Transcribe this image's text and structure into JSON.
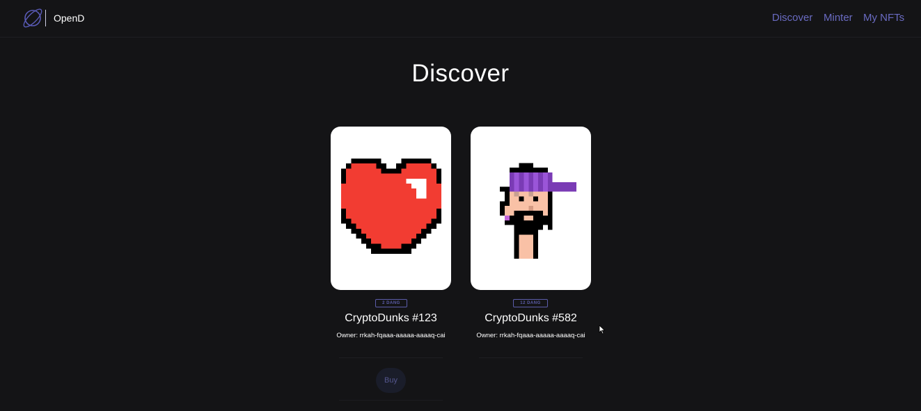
{
  "header": {
    "brand": "OpenD",
    "nav": [
      {
        "label": "Discover"
      },
      {
        "label": "Minter"
      },
      {
        "label": "My NFTs"
      }
    ]
  },
  "page": {
    "title": "Discover"
  },
  "cards": [
    {
      "image_icon": "pixel-heart",
      "badge": "2 DANG",
      "name": "CryptoDunks #123",
      "owner": "Owner: rrkah-fqaaa-aaaaa-aaaaq-cai",
      "buy_label": "Buy"
    },
    {
      "image_icon": "pixel-bearded-man-with-cap",
      "badge": "12 DANG",
      "name": "CryptoDunks #582",
      "owner": "Owner: rrkah-fqaaa-aaaaa-aaaaq-cai"
    }
  ],
  "colors": {
    "background": "#141416",
    "accent": "#6a6bc2",
    "heart": "#f23c32",
    "cap": "#7a3bb5",
    "skin": "#f9c1a6"
  }
}
